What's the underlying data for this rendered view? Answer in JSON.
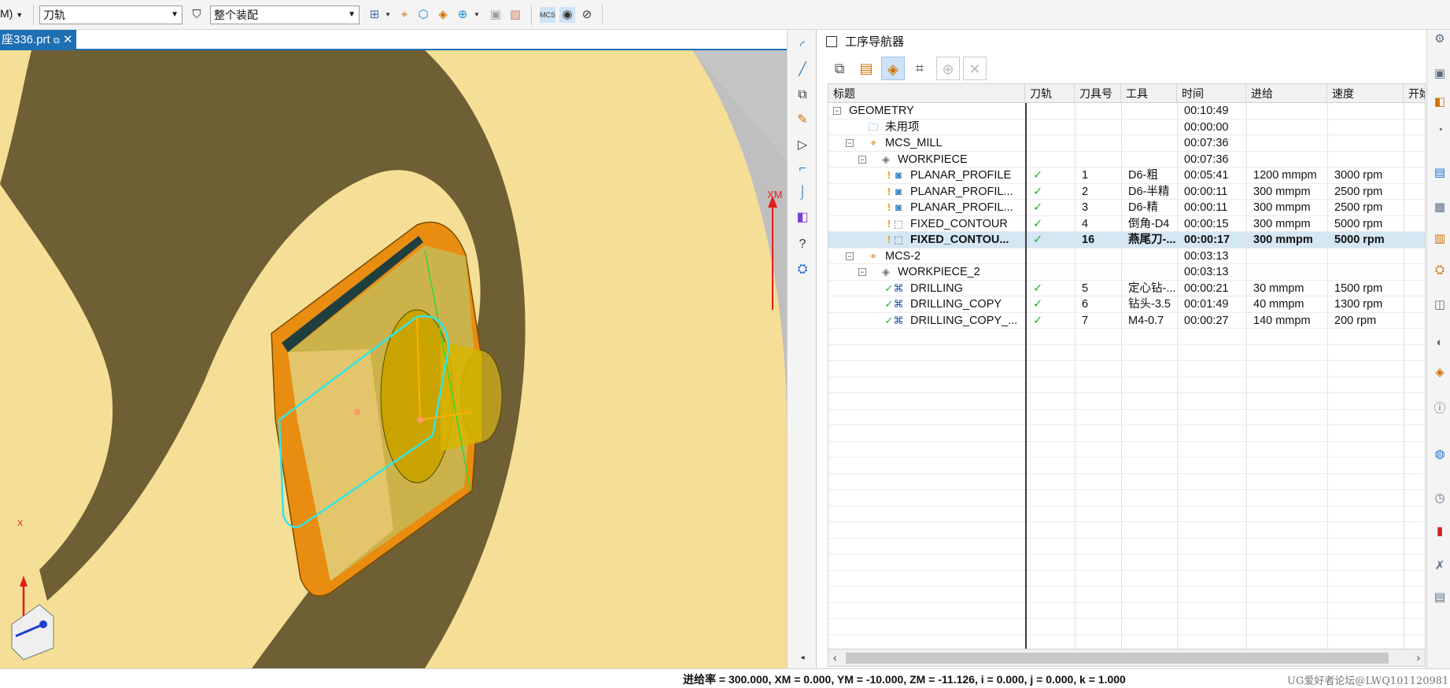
{
  "toolbar": {
    "menu_fragment": "M)",
    "filter_value": "刀轨",
    "scope_value": "整个装配"
  },
  "document_tab": {
    "title": "座336.prt"
  },
  "viewport": {
    "axis_label_xm": "XM",
    "triad_x_label": "X",
    "colors": {
      "background": "#c4c4c4",
      "part_face": "#f5df96",
      "wall": "#6e5f35",
      "toolpath": "#33e5e5",
      "edge": "#ff8c00"
    }
  },
  "navigator": {
    "title": "工序导航器",
    "columns": [
      "标题",
      "刀轨",
      "刀具号",
      "工具",
      "时间",
      "进给",
      "速度",
      "开始"
    ],
    "rows": [
      {
        "name": "GEOMETRY",
        "level": 0,
        "toggle": "−",
        "icon": "",
        "path": "",
        "tool_no": "",
        "tool": "",
        "time": "00:10:49",
        "feed": "",
        "speed": "",
        "status": "",
        "selected": false
      },
      {
        "name": "未用项",
        "level": 1,
        "toggle": "",
        "icon": "folder-icon",
        "path": "",
        "tool_no": "",
        "tool": "",
        "time": "00:00:00",
        "feed": "",
        "speed": "",
        "status": "",
        "selected": false
      },
      {
        "name": "MCS_MILL",
        "level": 1,
        "toggle": "−",
        "icon": "mcs-icon",
        "path": "",
        "tool_no": "",
        "tool": "",
        "time": "00:07:36",
        "feed": "",
        "speed": "",
        "status": "",
        "selected": false
      },
      {
        "name": "WORKPIECE",
        "level": 2,
        "toggle": "−",
        "icon": "workpiece-icon",
        "path": "",
        "tool_no": "",
        "tool": "",
        "time": "00:07:36",
        "feed": "",
        "speed": "",
        "status": "",
        "selected": false
      },
      {
        "name": "PLANAR_PROFILE",
        "level": 3,
        "toggle": "",
        "icon": "mill-op-icon",
        "path": "✓",
        "tool_no": "1",
        "tool": "D6-粗",
        "time": "00:05:41",
        "feed": "1200 mmpm",
        "speed": "3000 rpm",
        "status": "warn",
        "selected": false
      },
      {
        "name": "PLANAR_PROFIL...",
        "level": 3,
        "toggle": "",
        "icon": "mill-op-icon",
        "path": "✓",
        "tool_no": "2",
        "tool": "D6-半精",
        "time": "00:00:11",
        "feed": "300 mmpm",
        "speed": "2500 rpm",
        "status": "warn",
        "selected": false
      },
      {
        "name": "PLANAR_PROFIL...",
        "level": 3,
        "toggle": "",
        "icon": "mill-op-icon",
        "path": "✓",
        "tool_no": "3",
        "tool": "D6-精",
        "time": "00:00:11",
        "feed": "300 mmpm",
        "speed": "2500 rpm",
        "status": "warn",
        "selected": false
      },
      {
        "name": "FIXED_CONTOUR",
        "level": 3,
        "toggle": "",
        "icon": "contour-op-icon",
        "path": "✓",
        "tool_no": "4",
        "tool": "倒角-D4",
        "time": "00:00:15",
        "feed": "300 mmpm",
        "speed": "5000 rpm",
        "status": "warn",
        "selected": false
      },
      {
        "name": "FIXED_CONTOU...",
        "level": 3,
        "toggle": "",
        "icon": "contour-op-icon",
        "path": "✓",
        "tool_no": "16",
        "tool": "燕尾刀-...",
        "time": "00:00:17",
        "feed": "300 mmpm",
        "speed": "5000 rpm",
        "status": "warn",
        "selected": true
      },
      {
        "name": "MCS-2",
        "level": 1,
        "toggle": "−",
        "icon": "mcs-icon",
        "path": "",
        "tool_no": "",
        "tool": "",
        "time": "00:03:13",
        "feed": "",
        "speed": "",
        "status": "",
        "selected": false
      },
      {
        "name": "WORKPIECE_2",
        "level": 2,
        "toggle": "−",
        "icon": "workpiece-icon",
        "path": "",
        "tool_no": "",
        "tool": "",
        "time": "00:03:13",
        "feed": "",
        "speed": "",
        "status": "",
        "selected": false
      },
      {
        "name": "DRILLING",
        "level": 3,
        "toggle": "",
        "icon": "drill-op-icon",
        "path": "✓",
        "tool_no": "5",
        "tool": "定心钻-...",
        "time": "00:00:21",
        "feed": "30 mmpm",
        "speed": "1500 rpm",
        "status": "ok",
        "selected": false
      },
      {
        "name": "DRILLING_COPY",
        "level": 3,
        "toggle": "",
        "icon": "drill-op-icon",
        "path": "✓",
        "tool_no": "6",
        "tool": "钻头-3.5",
        "time": "00:01:49",
        "feed": "40 mmpm",
        "speed": "1300 rpm",
        "status": "ok",
        "selected": false
      },
      {
        "name": "DRILLING_COPY_...",
        "level": 3,
        "toggle": "",
        "icon": "drill-op-icon",
        "path": "✓",
        "tool_no": "7",
        "tool": "M4-0.7",
        "time": "00:00:27",
        "feed": "140 mmpm",
        "speed": "200 rpm",
        "status": "ok",
        "selected": false
      }
    ]
  },
  "status_bar": {
    "message": "进给率 = 300.000, XM = 0.000, YM = -10.000, ZM = -11.126, i = 0.000, j = 0.000, k = 1.000",
    "watermark": "UG爱好者论坛@LWQ101120981"
  }
}
